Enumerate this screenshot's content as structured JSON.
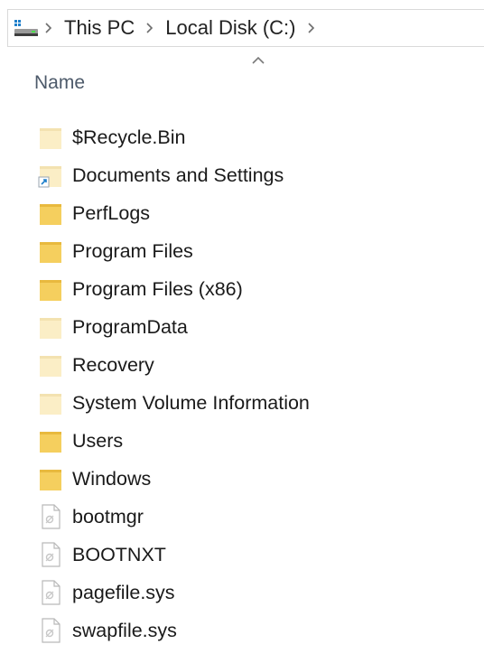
{
  "address_bar": {
    "crumbs": [
      "This PC",
      "Local Disk (C:)"
    ]
  },
  "columns": {
    "name": "Name",
    "sort_direction": "ascending"
  },
  "items": [
    {
      "label": "$Recycle.Bin",
      "type": "folder",
      "hidden": true,
      "shortcut": false
    },
    {
      "label": "Documents and Settings",
      "type": "folder",
      "hidden": true,
      "shortcut": true
    },
    {
      "label": "PerfLogs",
      "type": "folder",
      "hidden": false,
      "shortcut": false
    },
    {
      "label": "Program Files",
      "type": "folder",
      "hidden": false,
      "shortcut": false
    },
    {
      "label": "Program Files (x86)",
      "type": "folder",
      "hidden": false,
      "shortcut": false
    },
    {
      "label": "ProgramData",
      "type": "folder",
      "hidden": true,
      "shortcut": false
    },
    {
      "label": "Recovery",
      "type": "folder",
      "hidden": true,
      "shortcut": false
    },
    {
      "label": "System Volume Information",
      "type": "folder",
      "hidden": true,
      "shortcut": false
    },
    {
      "label": "Users",
      "type": "folder",
      "hidden": false,
      "shortcut": false
    },
    {
      "label": "Windows",
      "type": "folder",
      "hidden": false,
      "shortcut": false
    },
    {
      "label": "bootmgr",
      "type": "system-file",
      "hidden": true,
      "shortcut": false
    },
    {
      "label": "BOOTNXT",
      "type": "system-file",
      "hidden": true,
      "shortcut": false
    },
    {
      "label": "pagefile.sys",
      "type": "system-file",
      "hidden": true,
      "shortcut": false
    },
    {
      "label": "swapfile.sys",
      "type": "system-file",
      "hidden": true,
      "shortcut": false
    }
  ],
  "colors": {
    "folder": "#f5cf5e",
    "folder_tab": "#e8b93e",
    "folder_hidden": "#fbeec6",
    "accent": "#1e7fcb"
  }
}
